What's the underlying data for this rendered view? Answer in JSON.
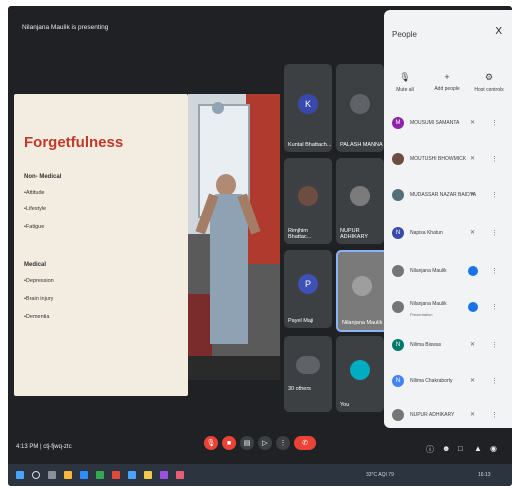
{
  "presenting_text": "Nilanjana Maulik is presenting",
  "slide": {
    "title": "Forgetfulness",
    "lines": [
      "Non- Medical",
      "•Attitude",
      "•Lifestyle",
      "•Fatigue",
      "Medical",
      "•Depression",
      "•Brain injury",
      "•Dementia"
    ]
  },
  "tiles": [
    {
      "name": "Kuntal Bhattach...",
      "initial": "K"
    },
    {
      "name": "PALASH MANNA"
    },
    {
      "name": "Rimjhim Bhattac..."
    },
    {
      "name": "NUPUR ADHIKARY"
    },
    {
      "name": "Payel Maji",
      "initial": "P"
    },
    {
      "name": "Nilanjana Maulik"
    },
    {
      "name": "30 others"
    },
    {
      "name": "You"
    }
  ],
  "bottom": {
    "time": "4:13 PM",
    "separator": "|",
    "code": "ctj-fjwq-ztc"
  },
  "panel": {
    "title": "People",
    "close": "X",
    "buttons": [
      "Mute all",
      "Add people",
      "Host controls"
    ],
    "participants": [
      {
        "name": "MOUSUMI SAMANTA",
        "initial": "M"
      },
      {
        "name": "MOUTUSHI BHOWMICK"
      },
      {
        "name": "MUDASSAR NAZAR BAIDYA"
      },
      {
        "name": "Napisa Khatun",
        "initial": "N"
      },
      {
        "name": "Nilanjana Maulik"
      },
      {
        "name": "Nilanjana Maulik",
        "sub": "Presentation"
      },
      {
        "name": "Nilima Biswas",
        "initial": "N"
      },
      {
        "name": "Nilima Chakraborty",
        "initial": "N"
      },
      {
        "name": "NUPUR ADHIKARY"
      }
    ]
  },
  "taskbar": {
    "weather": "33°C AQI 79",
    "clock": "16:13"
  },
  "colors": {
    "accent_red": "#ea4335",
    "meet_dark": "#202124",
    "blue": "#1a73e8",
    "slide_title": "#c0392b"
  }
}
